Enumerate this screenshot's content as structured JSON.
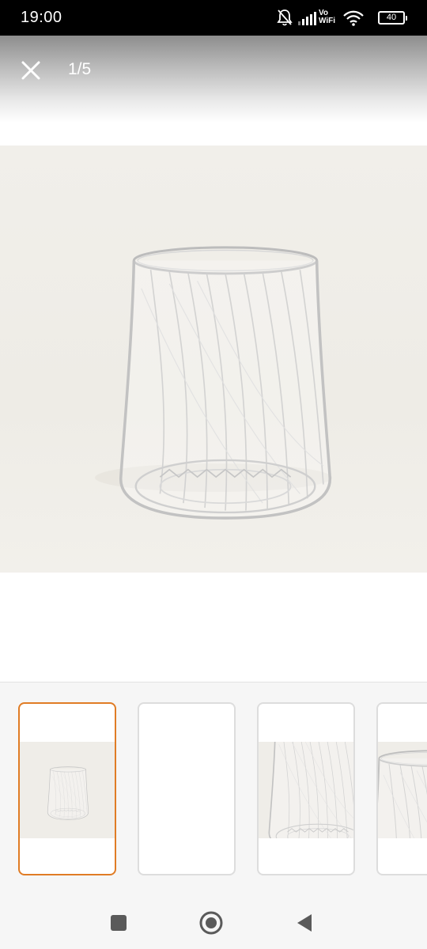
{
  "status_bar": {
    "time": "19:00",
    "icons": [
      "mute-bell-icon",
      "signal-icon",
      "vowifi-icon",
      "wifi-icon",
      "battery-icon"
    ],
    "vowifi_top": "Vo",
    "vowifi_bottom": "WiFi",
    "battery_level": "40"
  },
  "viewer": {
    "close_icon": "close-icon",
    "page_counter": "1/5",
    "current_index": 1,
    "total": 5
  },
  "main_image": {
    "subject": "ribbed clear drinking glass",
    "background_color": "#efede8"
  },
  "thumbnails": [
    {
      "state": "selected",
      "content": "full glass"
    },
    {
      "state": "default",
      "content": "blank"
    },
    {
      "state": "default",
      "content": "glass close-up"
    },
    {
      "state": "default",
      "content": "glass rim close-up"
    }
  ],
  "nav_bar": {
    "recents_icon": "square-icon",
    "home_icon": "circle-home-icon",
    "back_icon": "triangle-back-icon"
  },
  "colors": {
    "accent_selected": "#e07c25",
    "status_bar_bg": "#000000",
    "thumb_strip_bg": "#f6f6f6"
  }
}
